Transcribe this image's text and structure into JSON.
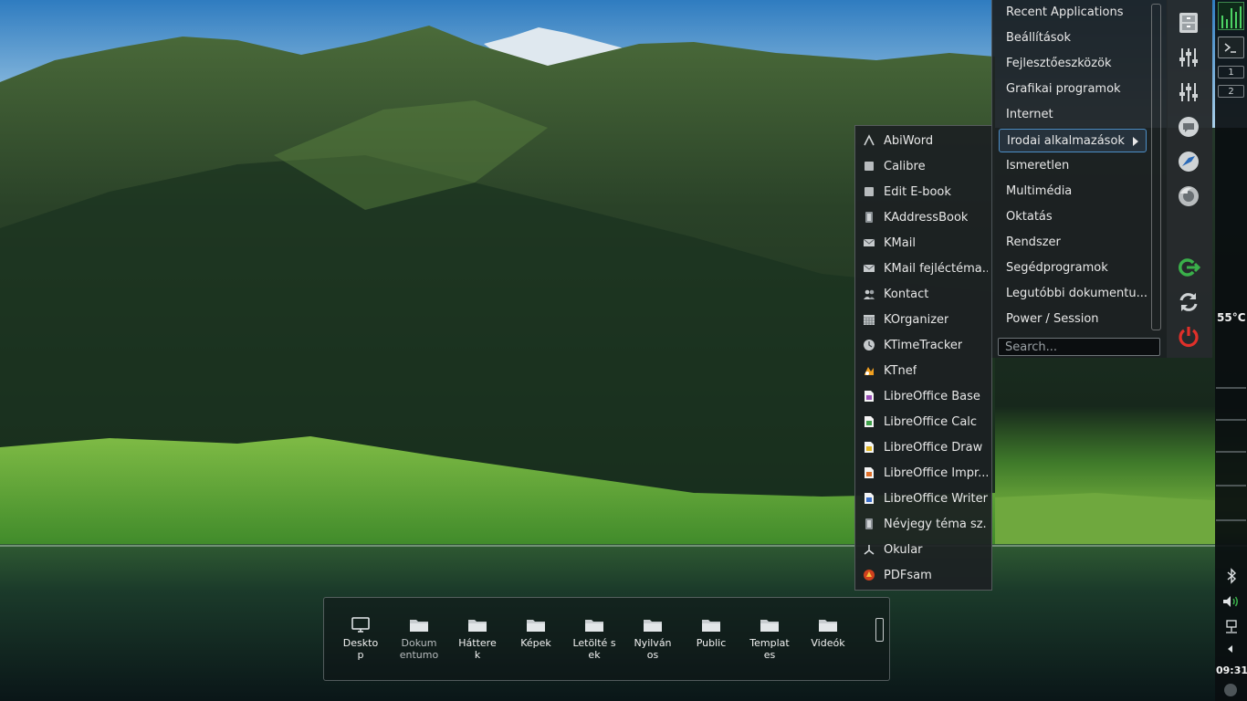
{
  "menu": {
    "items": [
      {
        "label": "Recent Applications"
      },
      {
        "label": "Beállítások"
      },
      {
        "label": "Fejlesztőeszközök"
      },
      {
        "label": "Grafikai programok"
      },
      {
        "label": "Internet"
      },
      {
        "label": "Irodai alkalmazások",
        "active": true
      },
      {
        "label": "Ismeretlen"
      },
      {
        "label": "Multimédia"
      },
      {
        "label": "Oktatás"
      },
      {
        "label": "Rendszer"
      },
      {
        "label": "Segédprogramok"
      },
      {
        "label": "Legutóbbi dokumentu..."
      },
      {
        "label": "Power / Session"
      }
    ],
    "search_placeholder": "Search..."
  },
  "submenu": {
    "items": [
      {
        "label": "AbiWord",
        "icon": "abiword-icon"
      },
      {
        "label": "Calibre",
        "icon": "calibre-icon"
      },
      {
        "label": "Edit E-book",
        "icon": "edit-ebook-icon"
      },
      {
        "label": "KAddressBook",
        "icon": "addressbook-icon"
      },
      {
        "label": "KMail",
        "icon": "mail-icon"
      },
      {
        "label": "KMail fejléctéma...",
        "icon": "mail-theme-icon"
      },
      {
        "label": "Kontact",
        "icon": "contacts-icon"
      },
      {
        "label": "KOrganizer",
        "icon": "calendar-icon"
      },
      {
        "label": "KTimeTracker",
        "icon": "clock-icon"
      },
      {
        "label": "KTnef",
        "icon": "ktnef-icon"
      },
      {
        "label": "LibreOffice Base",
        "icon": "libreoffice-base-icon"
      },
      {
        "label": "LibreOffice Calc",
        "icon": "libreoffice-calc-icon"
      },
      {
        "label": "LibreOffice Draw",
        "icon": "libreoffice-draw-icon"
      },
      {
        "label": "LibreOffice Impr...",
        "icon": "libreoffice-impress-icon"
      },
      {
        "label": "LibreOffice Writer",
        "icon": "libreoffice-writer-icon"
      },
      {
        "label": "Névjegy téma sz...",
        "icon": "contact-theme-icon"
      },
      {
        "label": "Okular",
        "icon": "okular-icon"
      },
      {
        "label": "PDFsam",
        "icon": "pdfsam-icon"
      }
    ]
  },
  "sidebar": {
    "buttons": [
      {
        "icon": "file-cabinet-icon"
      },
      {
        "icon": "settings-sliders-icon"
      },
      {
        "icon": "settings-sliders-alt-icon"
      },
      {
        "icon": "chat-icon"
      },
      {
        "icon": "bird-app-icon"
      },
      {
        "icon": "firefox-icon"
      },
      {
        "icon": "logout-icon"
      },
      {
        "icon": "restart-icon"
      },
      {
        "icon": "power-icon"
      }
    ]
  },
  "panel": {
    "pager": [
      "1",
      "2"
    ],
    "temperature": "55°C",
    "clock": "09:31",
    "tray_icons": [
      "bluetooth-icon",
      "volume-icon",
      "network-icon"
    ]
  },
  "folderview": {
    "items": [
      {
        "label": "Deskto p",
        "icon": "desktop-icon"
      },
      {
        "label": "Dokum entumo",
        "icon": "folder-icon",
        "dim_tail": true
      },
      {
        "label": "Háttere k",
        "icon": "folder-icon"
      },
      {
        "label": "Képek",
        "icon": "folder-icon"
      },
      {
        "label": "Letölté sek",
        "icon": "folder-icon"
      },
      {
        "label": "Nyilván os",
        "icon": "folder-icon"
      },
      {
        "label": "Public",
        "icon": "folder-icon"
      },
      {
        "label": "Templat es",
        "icon": "folder-icon"
      },
      {
        "label": "Videók",
        "icon": "folder-icon"
      }
    ]
  },
  "colors": {
    "accent": "#4d8fc8",
    "power_red": "#e0302a",
    "logout_green": "#3ab04a"
  }
}
